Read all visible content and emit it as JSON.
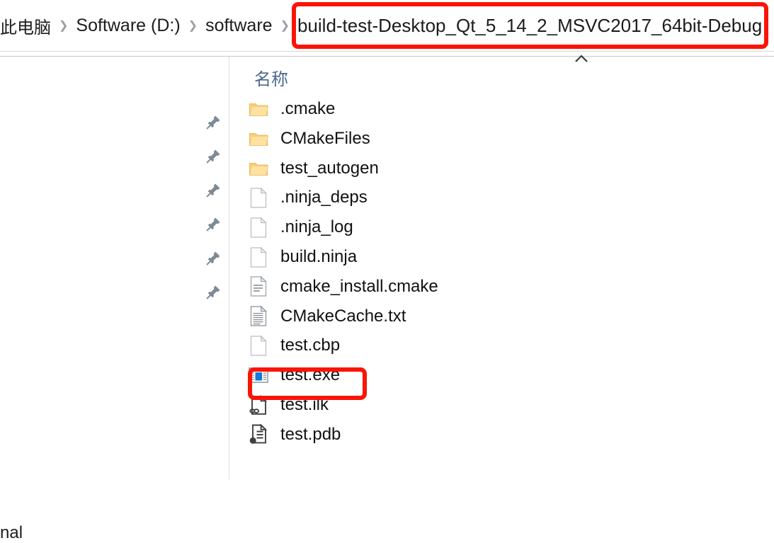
{
  "breadcrumb": {
    "separator": "❯",
    "items": [
      {
        "label": "此电脑",
        "cn": true
      },
      {
        "label": "Software (D:)",
        "cn": false
      },
      {
        "label": "software",
        "cn": false
      }
    ],
    "current": "build-test-Desktop_Qt_5_14_2_MSVC2017_64bit-Debug",
    "highlight_color": "#fb1405"
  },
  "ribbon": {
    "chevron_icon": "chevron-up-icon"
  },
  "nav_pane": {
    "pin_icon": "pushpin-icon",
    "pin_count": 6,
    "clipped_text": "nal"
  },
  "column_headers": {
    "name": "名称",
    "color": "#4a688f"
  },
  "file_list": {
    "items": [
      {
        "name": ".cmake",
        "icon": "folder-icon"
      },
      {
        "name": "CMakeFiles",
        "icon": "folder-icon"
      },
      {
        "name": "test_autogen",
        "icon": "folder-icon"
      },
      {
        "name": ".ninja_deps",
        "icon": "blank-file-icon"
      },
      {
        "name": ".ninja_log",
        "icon": "blank-file-icon"
      },
      {
        "name": "build.ninja",
        "icon": "blank-file-icon"
      },
      {
        "name": "cmake_install.cmake",
        "icon": "text-file-icon"
      },
      {
        "name": "CMakeCache.txt",
        "icon": "lined-text-file-icon"
      },
      {
        "name": "test.cbp",
        "icon": "blank-file-icon"
      },
      {
        "name": "test.exe",
        "icon": "application-exe-icon",
        "highlighted": true
      },
      {
        "name": "test.ilk",
        "icon": "link-file-icon"
      },
      {
        "name": "test.pdb",
        "icon": "database-file-icon"
      }
    ],
    "highlight_color": "#fb1405"
  }
}
